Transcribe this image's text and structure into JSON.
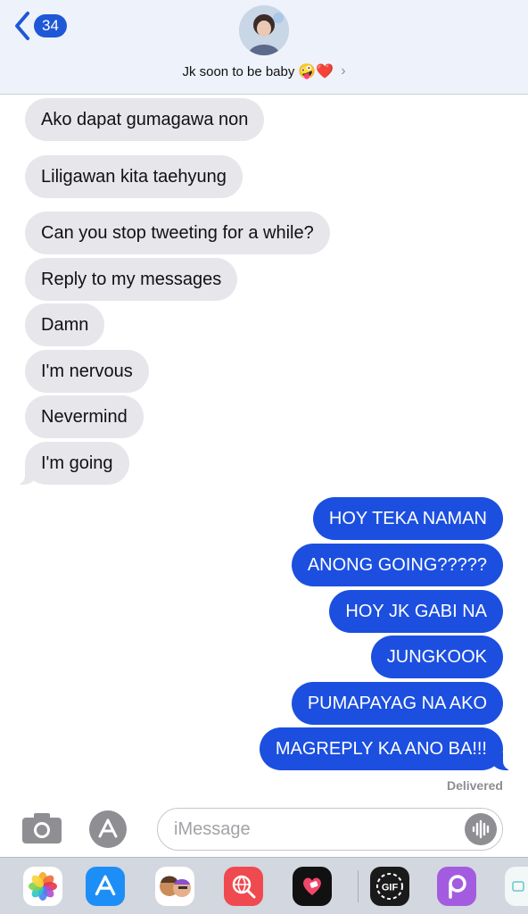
{
  "header": {
    "back_count": "34",
    "contact_name": "Jk soon to be baby",
    "contact_emojis": "🤪❤️",
    "chevron": "›"
  },
  "messages": [
    {
      "direction": "in",
      "text": "Ako dapat gumagawa non"
    },
    {
      "direction": "in",
      "text": "Liligawan kita taehyung"
    },
    {
      "direction": "in",
      "text": "Can you stop tweeting for a while?"
    },
    {
      "direction": "in",
      "text": "Reply to my messages"
    },
    {
      "direction": "in",
      "text": "Damn"
    },
    {
      "direction": "in",
      "text": "I'm nervous"
    },
    {
      "direction": "in",
      "text": "Nevermind"
    },
    {
      "direction": "in",
      "text": "I'm going"
    },
    {
      "direction": "out",
      "text": "HOY TEKA NAMAN"
    },
    {
      "direction": "out",
      "text": "ANONG GOING?????"
    },
    {
      "direction": "out",
      "text": "HOY JK GABI NA"
    },
    {
      "direction": "out",
      "text": "JUNGKOOK"
    },
    {
      "direction": "out",
      "text": "PUMAPAYAG NA AKO"
    },
    {
      "direction": "out",
      "text": "MAGREPLY KA ANO BA!!!"
    }
  ],
  "status": "Delivered",
  "composer": {
    "placeholder": "iMessage",
    "icons": [
      "camera-icon",
      "app-store-icon",
      "audio-waveform-icon"
    ]
  },
  "app_drawer": [
    "photos-app",
    "app-store-app",
    "memoji-app",
    "web-search-app",
    "heart-app",
    "gif-app",
    "picsart-app",
    "partial-app"
  ],
  "colors": {
    "outgoing_bubble": "#1c4fe0",
    "incoming_bubble": "#e6e6eb",
    "header_bg": "#eef2fb",
    "accent": "#1f58d6"
  }
}
